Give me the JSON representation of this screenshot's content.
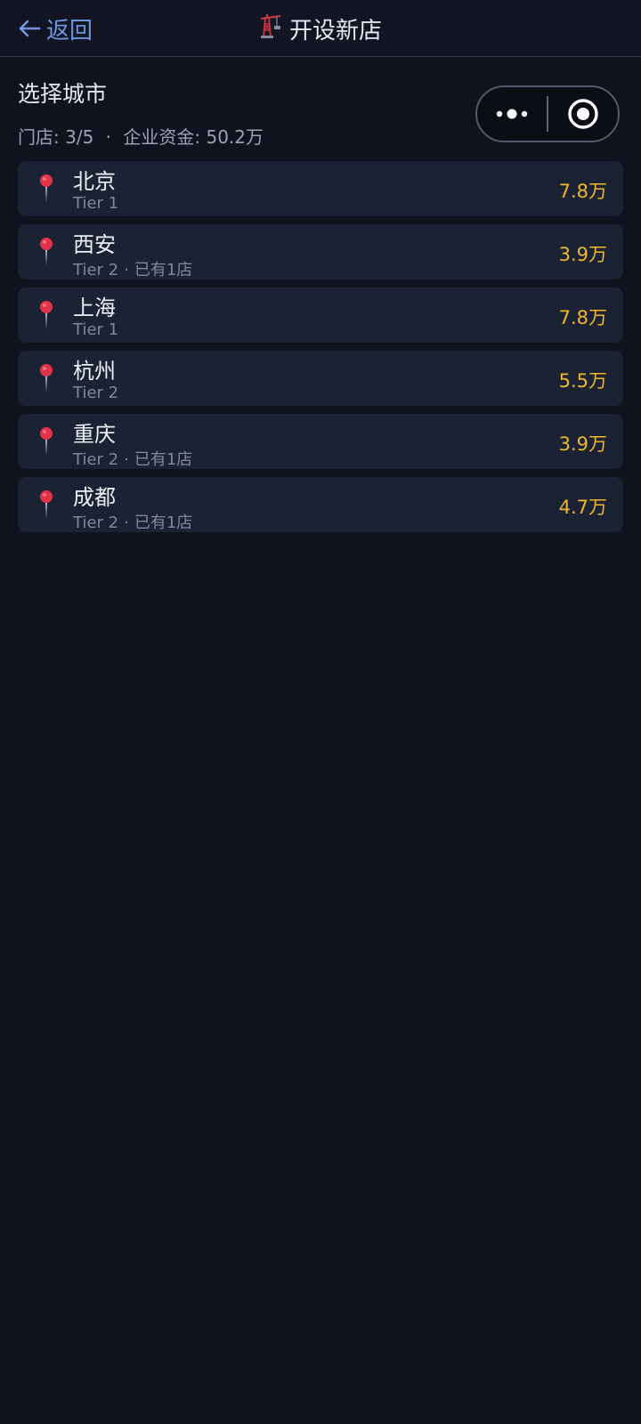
{
  "header": {
    "back_label": "返回",
    "title": "开设新店",
    "title_icon": "crane-icon"
  },
  "page": {
    "heading": "选择城市",
    "stores_label": "门店:",
    "stores_value": "3/5",
    "funds_label": "企业资金:",
    "funds_value": "50.2万"
  },
  "capsule": {
    "more_icon": "more-dots-icon",
    "target_icon": "target-circle-icon"
  },
  "cities": [
    {
      "name": "北京",
      "tier": "Tier 1",
      "note": "",
      "cost": "7.8万"
    },
    {
      "name": "西安",
      "tier": "Tier 2",
      "note": "已有1店",
      "cost": "3.9万"
    },
    {
      "name": "上海",
      "tier": "Tier 1",
      "note": "",
      "cost": "7.8万"
    },
    {
      "name": "杭州",
      "tier": "Tier 2",
      "note": "",
      "cost": "5.5万"
    },
    {
      "name": "重庆",
      "tier": "Tier 2",
      "note": "已有1店",
      "cost": "3.9万"
    },
    {
      "name": "成都",
      "tier": "Tier 2",
      "note": "已有1店",
      "cost": "4.7万"
    }
  ],
  "colors": {
    "background": "#10121d",
    "card": "#1a2234",
    "accent_blue": "#6f94e2",
    "cost_gold": "#f1b829",
    "pin_red": "#e0334a"
  }
}
